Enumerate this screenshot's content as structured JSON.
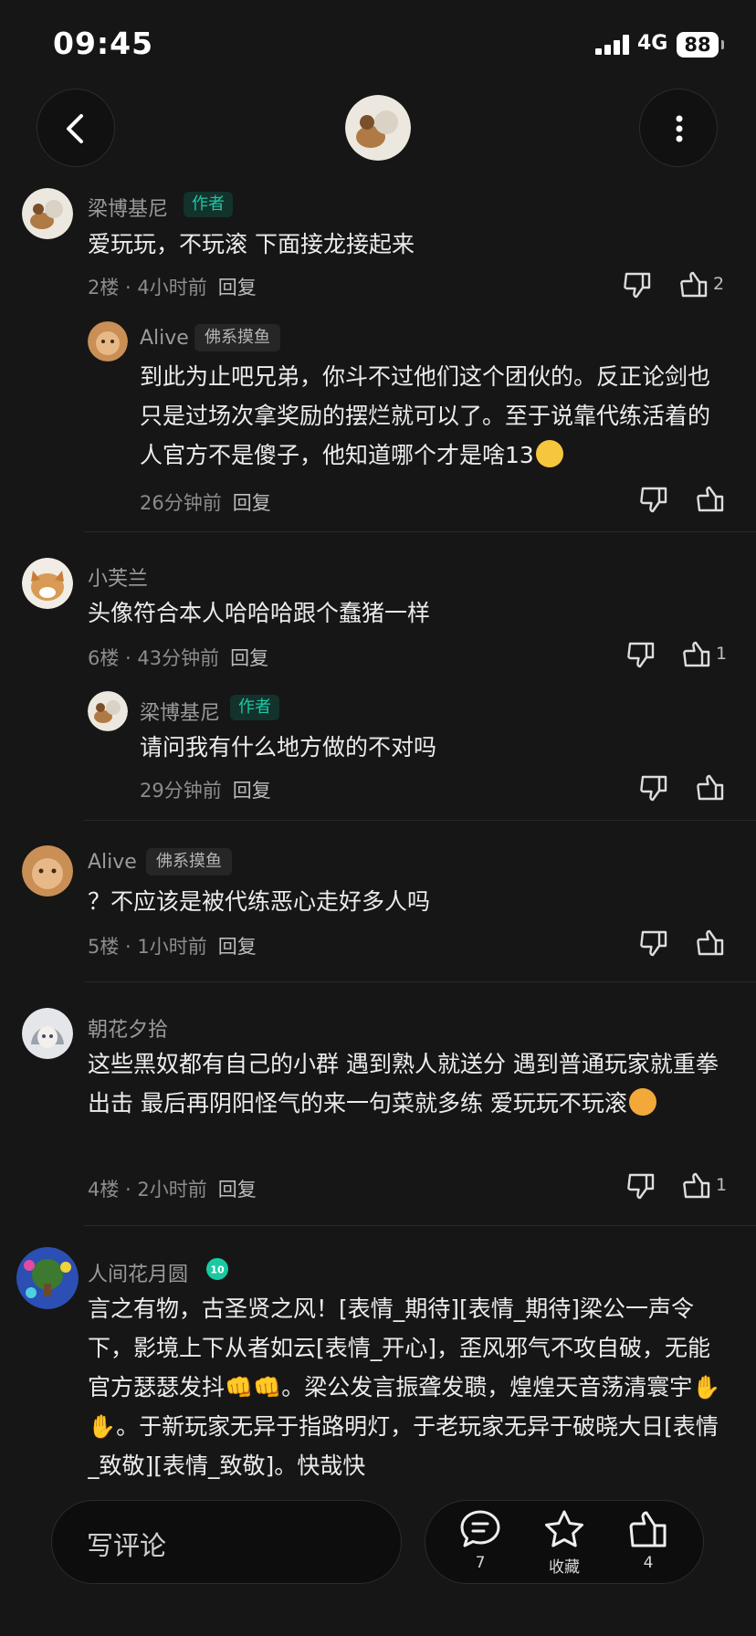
{
  "status": {
    "time": "09:45",
    "network": "4G",
    "battery": "88"
  },
  "comments": [
    {
      "name": "梁博基尼",
      "badge": "作者",
      "text": "爱玩玩，不玩滚 下面接龙接起来",
      "floor": "2楼",
      "time": "4小时前",
      "reply": "回复",
      "likes": "2",
      "replies": [
        {
          "name": "Alive",
          "badge": "佛系摸鱼",
          "text": "到此为止吧兄弟，你斗不过他们这个团伙的。反正论剑也只是过场次拿奖励的摆烂就可以了。至于说靠代练活着的人官方不是傻子，他知道哪个才是啥13",
          "time": "26分钟前",
          "reply": "回复"
        }
      ]
    },
    {
      "name": "小芙兰",
      "text": "头像符合本人哈哈哈跟个蠢猪一样",
      "floor": "6楼",
      "time": "43分钟前",
      "reply": "回复",
      "likes": "1",
      "replies": [
        {
          "name": "梁博基尼",
          "badge": "作者",
          "text": "请问我有什么地方做的不对吗",
          "time": "29分钟前",
          "reply": "回复"
        }
      ]
    },
    {
      "name": "Alive",
      "badge": "佛系摸鱼",
      "text": "？不应该是被代练恶心走好多人吗",
      "floor": "5楼",
      "time": "1小时前",
      "reply": "回复"
    },
    {
      "name": "朝花夕拾",
      "text": "这些黑奴都有自己的小群 遇到熟人就送分 遇到普通玩家就重拳出击 最后再阴阳怪气的来一句菜就多练 爱玩玩不玩滚",
      "floor": "4楼",
      "time": "2小时前",
      "reply": "回复",
      "likes": "1"
    },
    {
      "name": "人间花月圆",
      "level": "10",
      "text": "言之有物，古圣贤之风！[表情_期待][表情_期待]梁公一声令下，影境上下从者如云[表情_开心]，歪风邪气不攻自破，无能官方瑟瑟发抖👊👊。梁公发言振聋发聩，煌煌天音荡清寰宇✋✋。于新玩家无异于指路明灯，于老玩家无异于破晓大日[表情_致敬][表情_致敬]。快哉快"
    }
  ],
  "bottom": {
    "input_placeholder": "写评论",
    "comment_count": "7",
    "favorite_label": "收藏",
    "like_count": "4"
  },
  "icons": [
    "back-arrow-icon",
    "more-vert-icon",
    "thumb-down-icon",
    "thumb-up-icon",
    "comment-bubble-icon",
    "star-icon"
  ],
  "colors": {
    "background": "#161616",
    "author_badge": "#1ec7a3",
    "meta": "#8c8c8c"
  }
}
